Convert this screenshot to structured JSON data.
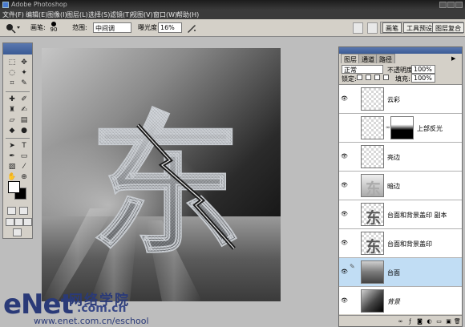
{
  "window": {
    "title": "Adobe Photoshop"
  },
  "menu": [
    "文件(F)",
    "编辑(E)",
    "图像(I)",
    "图层(L)",
    "选择(S)",
    "滤镜(T)",
    "视图(V)",
    "窗口(W)",
    "帮助(H)"
  ],
  "options": {
    "brush_label": "画笔:",
    "brush_size": "90",
    "range_label": "范围:",
    "range_value": "中间调",
    "exposure_label": "曝光度:",
    "exposure_value": "16%",
    "well_tabs": [
      "画笔",
      "工具预设",
      "图层复合"
    ]
  },
  "watermark": {
    "brand": "eNet",
    "chinese": "网络学院",
    "domain": ".com.cn",
    "url": "www.enet.com.cn/eschool"
  },
  "layers_panel": {
    "tabs": [
      "图层",
      "通道",
      "路径"
    ],
    "blend_mode": "正常",
    "opacity_label": "不透明度:",
    "opacity_value": "100%",
    "lock_label": "锁定:",
    "fill_label": "填充:",
    "fill_value": "100%",
    "layers": [
      {
        "name": "云彩",
        "visible": true,
        "selected": false,
        "has_mask": false
      },
      {
        "name": "上部反光",
        "visible": false,
        "selected": false,
        "has_mask": true
      },
      {
        "name": "亮边",
        "visible": true,
        "selected": false,
        "has_mask": false
      },
      {
        "name": "暗边",
        "visible": true,
        "selected": false,
        "has_mask": false
      },
      {
        "name": "台面和背景盖印 副本",
        "visible": true,
        "selected": false,
        "has_mask": false
      },
      {
        "name": "台面和背景盖印",
        "visible": true,
        "selected": false,
        "has_mask": false
      },
      {
        "name": "台面",
        "visible": true,
        "selected": true,
        "has_mask": false
      },
      {
        "name": "背景",
        "visible": true,
        "selected": false,
        "has_mask": false
      }
    ]
  },
  "colors": {
    "selected_layer": "#c1ddf4",
    "panel_bg": "#d4d0c8",
    "watermark": "#2a3a78"
  },
  "canvas": {
    "glyph": "东"
  }
}
